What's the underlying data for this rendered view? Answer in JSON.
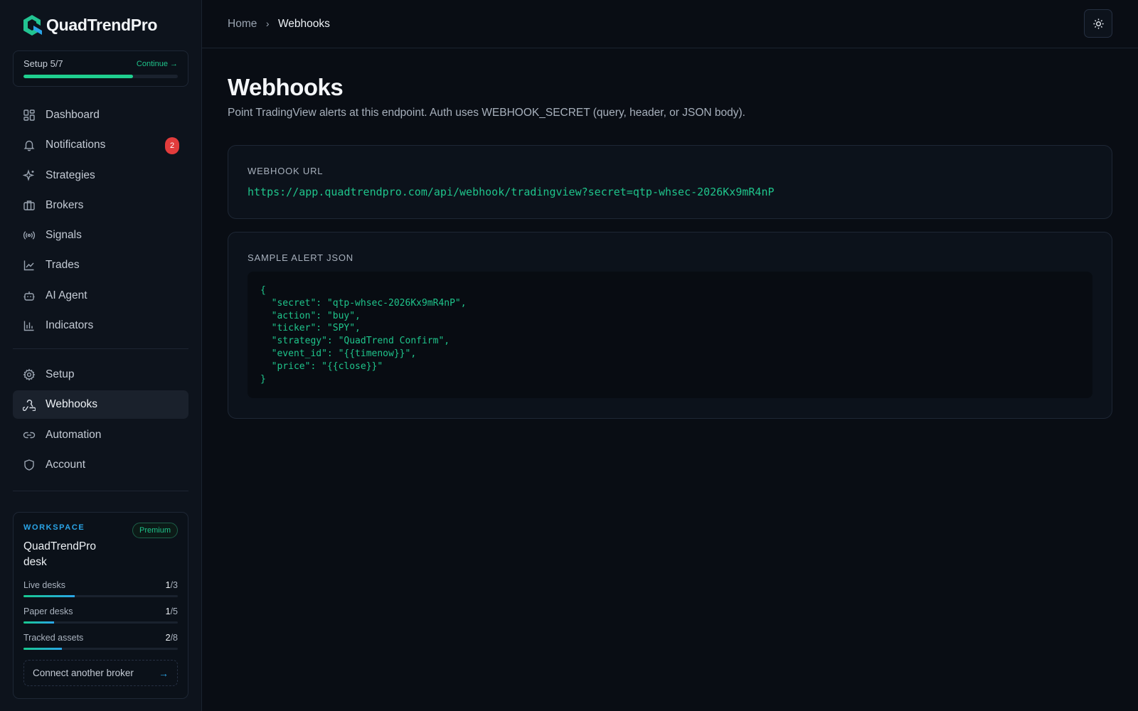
{
  "brand": {
    "name": "QuadTrendPro"
  },
  "setup": {
    "title": "Setup 5/7",
    "continue_label": "Continue →",
    "progress": 0.71
  },
  "nav_primary": [
    {
      "label": "Dashboard",
      "icon": "dashboard-icon"
    },
    {
      "label": "Notifications",
      "icon": "bell-icon",
      "badge": "2"
    },
    {
      "label": "Strategies",
      "icon": "sparkles-icon"
    },
    {
      "label": "Brokers",
      "icon": "briefcase-icon"
    },
    {
      "label": "Signals",
      "icon": "radio-signal-icon"
    },
    {
      "label": "Trades",
      "icon": "line-chart-icon"
    },
    {
      "label": "AI Agent",
      "icon": "bot-icon"
    },
    {
      "label": "Indicators",
      "icon": "bar-chart-icon"
    }
  ],
  "nav_secondary": [
    {
      "label": "Setup",
      "icon": "gear-icon"
    },
    {
      "label": "Webhooks",
      "icon": "webhook-icon",
      "active": true
    },
    {
      "label": "Automation",
      "icon": "link-icon"
    },
    {
      "label": "Account",
      "icon": "shield-icon"
    }
  ],
  "workspace": {
    "label": "WORKSPACE",
    "name": "QuadTrendPro desk",
    "plan": "Premium",
    "quotas": [
      {
        "label": "Live desks",
        "used": "1",
        "total": "/3",
        "fraction": 0.33
      },
      {
        "label": "Paper desks",
        "used": "1",
        "total": "/5",
        "fraction": 0.2
      },
      {
        "label": "Tracked assets",
        "used": "2",
        "total": "/8",
        "fraction": 0.25
      }
    ],
    "connect_label": "Connect another broker",
    "connect_arrow": "→"
  },
  "breadcrumb": {
    "home": "Home",
    "separator": "›",
    "current": "Webhooks"
  },
  "theme_toggle": {
    "icon": "sun-icon"
  },
  "page": {
    "title": "Webhooks",
    "description": "Point TradingView alerts at this endpoint. Auth uses WEBHOOK_SECRET (query, header, or JSON body)."
  },
  "webhook_url": {
    "label": "WEBHOOK URL",
    "value": "https://app.quadtrendpro.com/api/webhook/tradingview?secret=qtp-whsec-2026Kx9mR4nP"
  },
  "sample_json": {
    "label": "SAMPLE ALERT JSON",
    "code": "{\n  \"secret\": \"qtp-whsec-2026Kx9mR4nP\",\n  \"action\": \"buy\",\n  \"ticker\": \"SPY\",\n  \"strategy\": \"QuadTrend Confirm\",\n  \"event_id\": \"{{timenow}}\",\n  \"price\": \"{{close}}\"\n}"
  },
  "colors": {
    "accent_green": "#1fc48b",
    "accent_blue": "#2aa5e8",
    "badge_red": "#e23c3c",
    "background": "#090d14",
    "sidebar": "#0d131c"
  }
}
